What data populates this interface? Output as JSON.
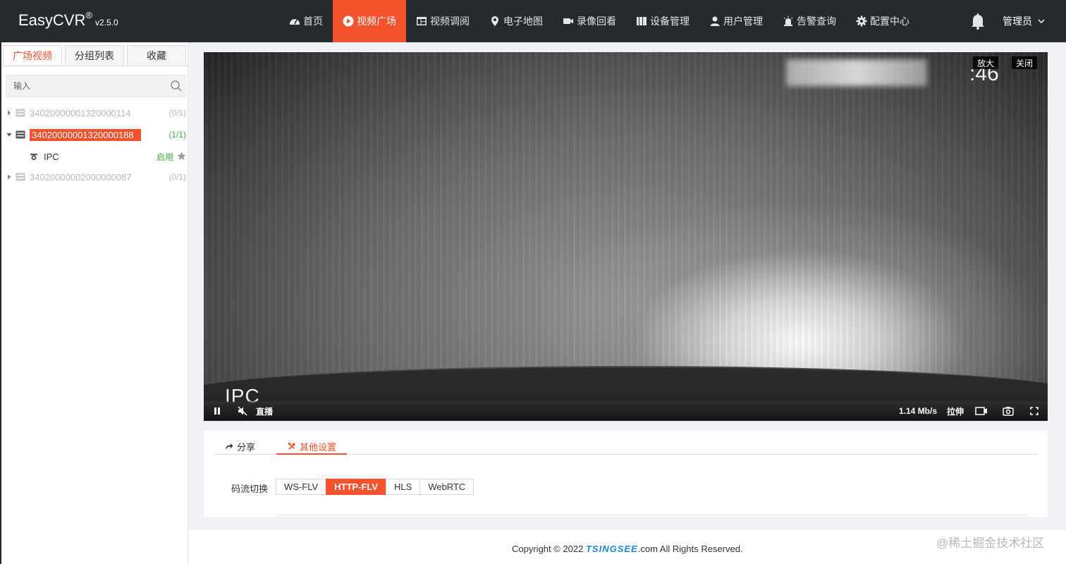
{
  "brand": {
    "name": "EasyCVR",
    "mark": "®",
    "version": "v2.5.0"
  },
  "nav": {
    "items": [
      {
        "label": "首页",
        "icon": "dashboard-icon",
        "active": false
      },
      {
        "label": "视频广场",
        "icon": "play-circle-icon",
        "active": true
      },
      {
        "label": "视频调阅",
        "icon": "grid-layout-icon",
        "active": false
      },
      {
        "label": "电子地图",
        "icon": "map-marker-icon",
        "active": false
      },
      {
        "label": "录像回看",
        "icon": "video-camera-icon",
        "active": false
      },
      {
        "label": "设备管理",
        "icon": "device-icon",
        "active": false
      },
      {
        "label": "用户管理",
        "icon": "user-icon",
        "active": false
      },
      {
        "label": "告警查询",
        "icon": "alarm-icon",
        "active": false
      },
      {
        "label": "配置中心",
        "icon": "gear-icon",
        "active": false
      }
    ],
    "user_label": "管理员"
  },
  "sidebar": {
    "tabs": [
      "广场视频",
      "分组列表",
      "收藏"
    ],
    "active_tab": 0,
    "search_placeholder": "输入",
    "devices": [
      {
        "id": "34020000001320000114",
        "count": "(0/1)",
        "online": false,
        "expanded": false,
        "selected": false
      },
      {
        "id": "34020000001320000188",
        "count": "(1/1)",
        "online": true,
        "expanded": true,
        "selected": true
      },
      {
        "id": "34020000002000000087",
        "count": "(0/1)",
        "online": false,
        "expanded": false,
        "selected": false
      }
    ],
    "channel": {
      "name": "IPC",
      "status": "启用"
    }
  },
  "video": {
    "osd_name": "IPC",
    "osd_time_fragment": ":46",
    "enlarge_label": "放大",
    "close_label": "关闭",
    "live_label": "直播",
    "bitrate": "1.14 Mb/s",
    "stretch_label": "拉伸"
  },
  "settings_panel": {
    "tabs": [
      {
        "label": "分享",
        "icon": "share-icon",
        "active": false
      },
      {
        "label": "其他设置",
        "icon": "tools-icon",
        "active": true
      }
    ],
    "stream_label": "码流切换",
    "stream_options": [
      "WS-FLV",
      "HTTP-FLV",
      "HLS",
      "WebRTC"
    ],
    "stream_selected": "HTTP-FLV"
  },
  "footer": {
    "copyright_prefix": "Copyright © 2022 ",
    "copyright_brand": "TSINGSEE",
    "copyright_suffix": ".com All Rights Reserved."
  },
  "watermark": "@稀土掘金技术社区",
  "colors": {
    "accent": "#f5522d",
    "topbar": "#26292e",
    "online": "#3cad3c",
    "brand_blue": "#1c8ad8"
  }
}
